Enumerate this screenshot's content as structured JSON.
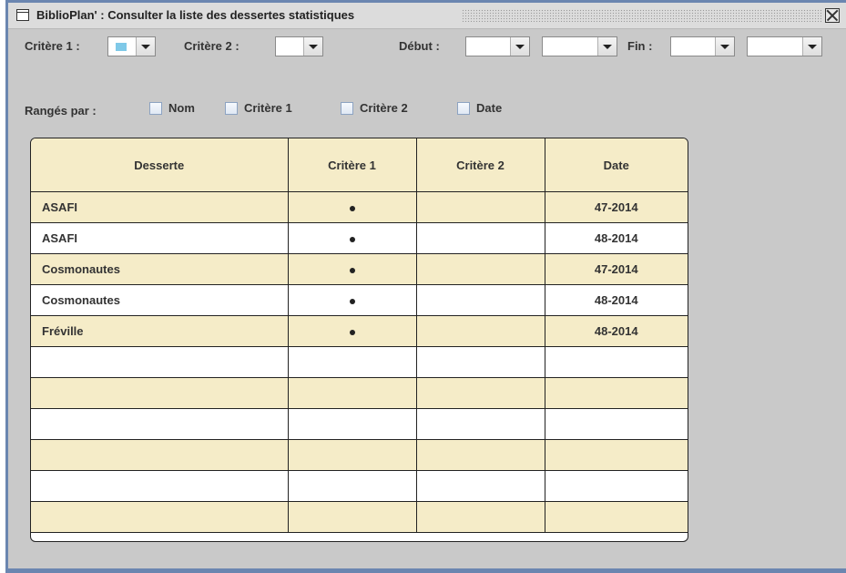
{
  "window": {
    "title": "BiblioPlan' : Consulter la liste des dessertes statistiques"
  },
  "filters": {
    "critere1_label": "Critère 1 :",
    "critere1_color": "#7fc9e8",
    "critere2_label": "Critère 2 :",
    "debut_label": "Début :",
    "fin_label": "Fin :"
  },
  "sort": {
    "label": "Rangés par :",
    "options": [
      {
        "label": "Nom",
        "checked": false
      },
      {
        "label": "Critère 1",
        "checked": false
      },
      {
        "label": "Critère 2",
        "checked": false
      },
      {
        "label": "Date",
        "checked": false
      }
    ]
  },
  "table": {
    "headers": [
      "Desserte",
      "Critère 1",
      "Critère 2",
      "Date"
    ],
    "rows": [
      {
        "desserte": "ASAFI",
        "critere1": true,
        "critere2": false,
        "date": "47-2014"
      },
      {
        "desserte": "ASAFI",
        "critere1": true,
        "critere2": false,
        "date": "48-2014"
      },
      {
        "desserte": "Cosmonautes",
        "critere1": true,
        "critere2": false,
        "date": "47-2014"
      },
      {
        "desserte": "Cosmonautes",
        "critere1": true,
        "critere2": false,
        "date": "48-2014"
      },
      {
        "desserte": "Fréville",
        "critere1": true,
        "critere2": false,
        "date": "48-2014"
      }
    ],
    "empty_rows": 6
  }
}
